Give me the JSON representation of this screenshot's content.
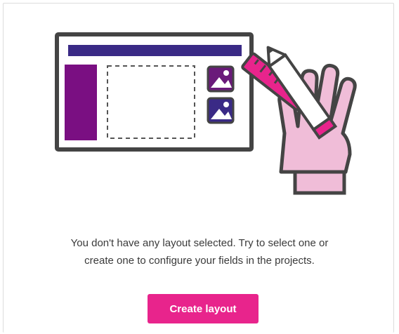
{
  "empty_state": {
    "illustration_icon": "layout-editing-hand-pencil-illustration",
    "message_line_1": "You don't have any layout selected. Try to select one or",
    "message_line_2": "create one to configure your fields in the projects.",
    "create_button_label": "Create layout"
  },
  "colors": {
    "accent": "#e8248c",
    "header_bar": "#3a2a86",
    "sidebar_block": "#7a0f82",
    "frame": "#444444",
    "hand": "#f0bdd8",
    "text": "#3a3a3a"
  }
}
